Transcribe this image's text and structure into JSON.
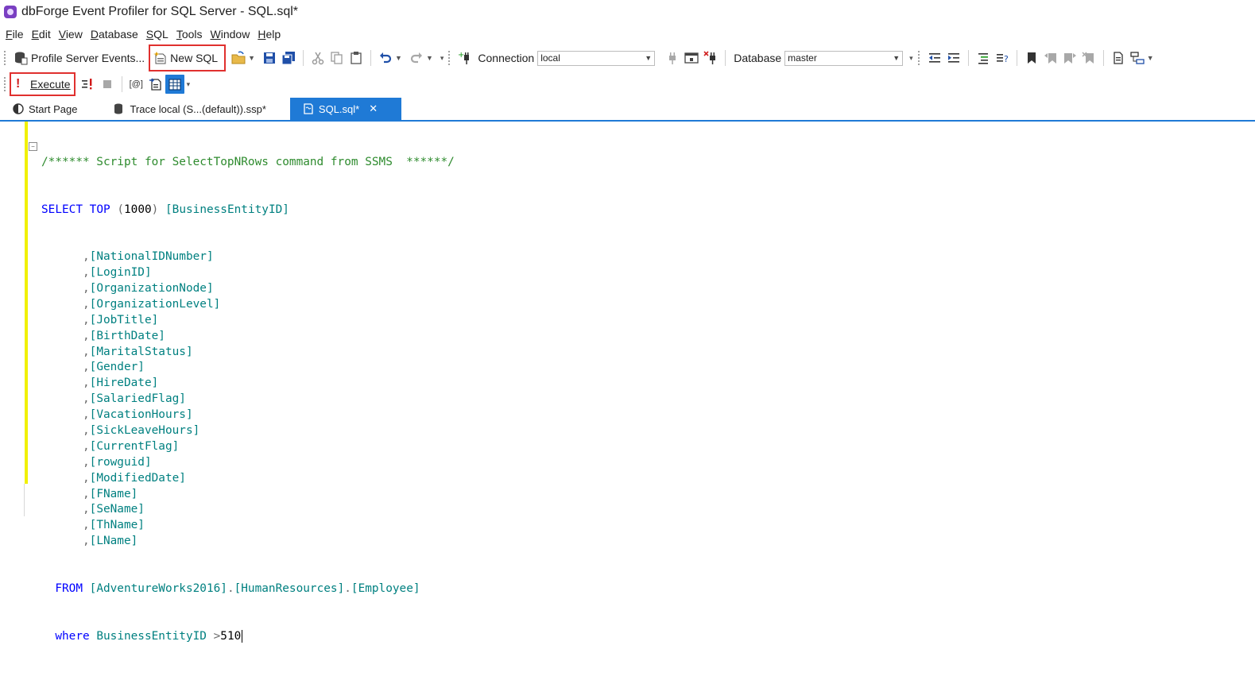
{
  "window": {
    "title": "dbForge Event Profiler for SQL Server - SQL.sql*"
  },
  "menu": {
    "items": [
      {
        "label": "File",
        "accel": "F",
        "rest": "ile"
      },
      {
        "label": "Edit",
        "accel": "E",
        "rest": "dit"
      },
      {
        "label": "View",
        "accel": "V",
        "rest": "iew"
      },
      {
        "label": "Database",
        "accel": "D",
        "rest": "atabase"
      },
      {
        "label": "SQL",
        "accel": "S",
        "rest": "QL"
      },
      {
        "label": "Tools",
        "accel": "T",
        "rest": "ools"
      },
      {
        "label": "Window",
        "accel": "W",
        "rest": "indow"
      },
      {
        "label": "Help",
        "accel": "H",
        "rest": "elp"
      }
    ]
  },
  "toolbar1": {
    "profile_label": "Profile Server Events...",
    "new_sql_label": "New SQL",
    "connection_label": "Connection",
    "connection_value": "local",
    "database_label": "Database",
    "database_value": "master"
  },
  "toolbar2": {
    "execute_label": "Execute"
  },
  "tabs": [
    {
      "label": "Start Page",
      "icon": "start-page-icon"
    },
    {
      "label": "Trace local (S...(default)).ssp*",
      "icon": "trace-icon"
    },
    {
      "label": "SQL.sql*",
      "icon": "sql-doc-icon"
    }
  ],
  "editor": {
    "comment": "/****** Script for SelectTopNRows command from SSMS  ******/",
    "select_kw": "SELECT",
    "top_kw": "TOP",
    "top_value": "1000",
    "first_column": "[BusinessEntityID]",
    "columns": [
      "[NationalIDNumber]",
      "[LoginID]",
      "[OrganizationNode]",
      "[OrganizationLevel]",
      "[JobTitle]",
      "[BirthDate]",
      "[MaritalStatus]",
      "[Gender]",
      "[HireDate]",
      "[SalariedFlag]",
      "[VacationHours]",
      "[SickLeaveHours]",
      "[CurrentFlag]",
      "[rowguid]",
      "[ModifiedDate]",
      "[FName]",
      "[SeName]",
      "[ThName]",
      "[LName]"
    ],
    "from_kw": "FROM",
    "db": "[AdventureWorks2016]",
    "schema": "[HumanResources]",
    "table": "[Employee]",
    "where_kw": "where",
    "where_column": "BusinessEntityID",
    "where_op": ">",
    "where_value": "510"
  },
  "colors": {
    "accent": "#1f7ad6",
    "highlight_box": "#e0302e",
    "keyword": "#0000ff",
    "identifier": "#008080",
    "comment": "#2e8b2e",
    "change_bar": "#f0f000"
  }
}
